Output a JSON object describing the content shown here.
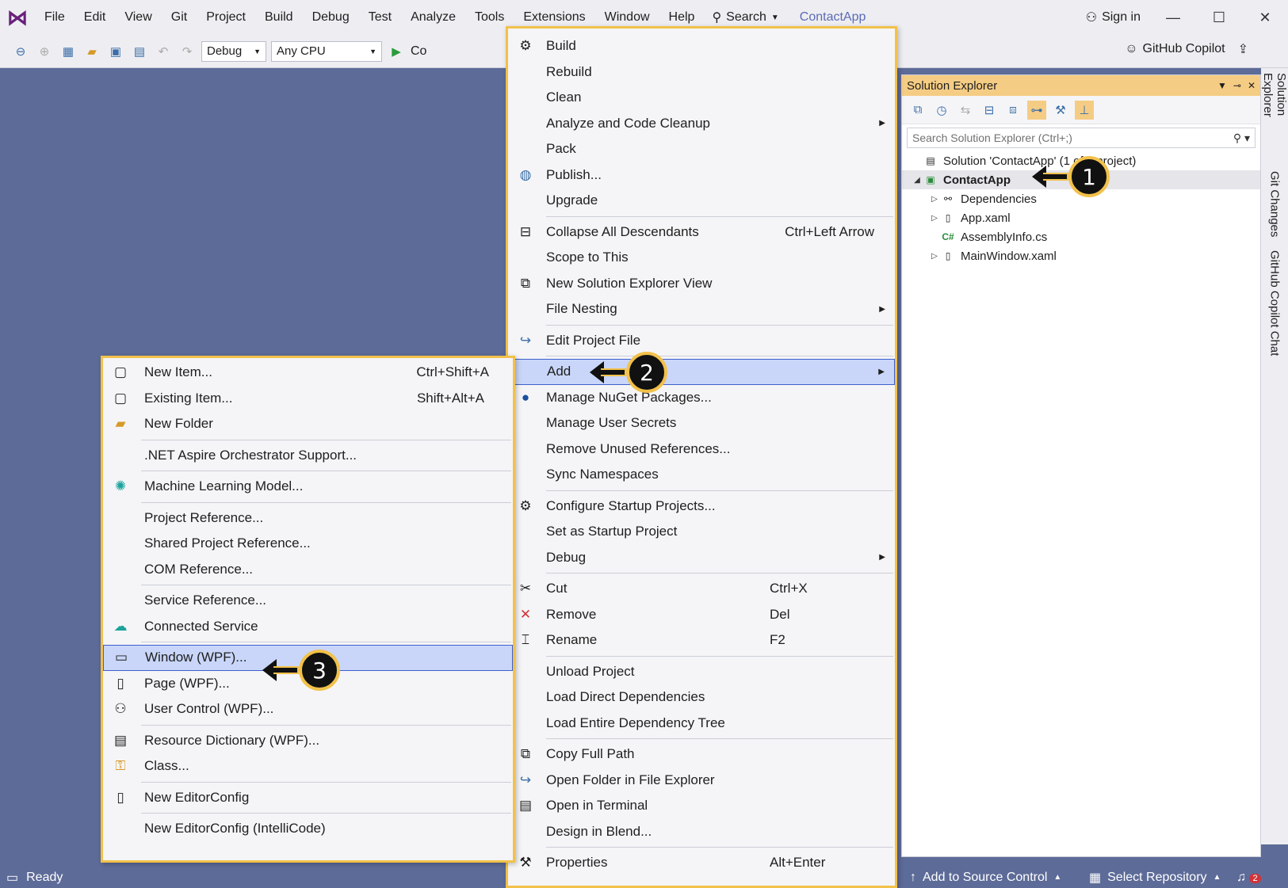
{
  "titlebar": {
    "menus": [
      "File",
      "Edit",
      "View",
      "Git",
      "Project",
      "Build",
      "Debug",
      "Test",
      "Analyze",
      "Tools",
      "Extensions",
      "Window",
      "Help"
    ],
    "search_label": "Search",
    "app_title": "ContactApp",
    "sign_in": "Sign in"
  },
  "toolbar": {
    "config": "Debug",
    "platform": "Any CPU",
    "run_label": "Co",
    "copilot": "GitHub Copilot"
  },
  "solution_explorer": {
    "title": "Solution Explorer",
    "search_placeholder": "Search Solution Explorer (Ctrl+;)",
    "solution": "Solution 'ContactApp' (1 of 1 project)",
    "project": "ContactApp",
    "items": [
      "Dependencies",
      "App.xaml",
      "AssemblyInfo.cs",
      "MainWindow.xaml"
    ]
  },
  "side_tabs": [
    "Solution Explorer",
    "Git Changes",
    "GitHub Copilot Chat"
  ],
  "main_menu": {
    "build": "Build",
    "rebuild": "Rebuild",
    "clean": "Clean",
    "analyze": "Analyze and Code Cleanup",
    "pack": "Pack",
    "publish": "Publish...",
    "upgrade": "Upgrade",
    "collapse": "Collapse All Descendants",
    "collapse_sc": "Ctrl+Left Arrow",
    "scope": "Scope to This",
    "new_view": "New Solution Explorer View",
    "file_nesting": "File Nesting",
    "edit_project": "Edit Project File",
    "add": "Add",
    "nuget": "Manage NuGet Packages...",
    "secrets": "Manage User Secrets",
    "remove_refs": "Remove Unused References...",
    "sync_ns": "Sync Namespaces",
    "config_startup": "Configure Startup Projects...",
    "set_startup": "Set as Startup Project",
    "debug": "Debug",
    "cut": "Cut",
    "cut_sc": "Ctrl+X",
    "remove": "Remove",
    "remove_sc": "Del",
    "rename": "Rename",
    "rename_sc": "F2",
    "unload": "Unload Project",
    "load_direct": "Load Direct Dependencies",
    "load_tree": "Load Entire Dependency Tree",
    "copy_path": "Copy Full Path",
    "open_folder": "Open Folder in File Explorer",
    "open_terminal": "Open in Terminal",
    "blend": "Design in Blend...",
    "properties": "Properties",
    "properties_sc": "Alt+Enter"
  },
  "add_menu": {
    "new_item": "New Item...",
    "new_item_sc": "Ctrl+Shift+A",
    "existing_item": "Existing Item...",
    "existing_item_sc": "Shift+Alt+A",
    "new_folder": "New Folder",
    "aspire": ".NET Aspire Orchestrator Support...",
    "ml_model": "Machine Learning Model...",
    "project_ref": "Project Reference...",
    "shared_ref": "Shared Project Reference...",
    "com_ref": "COM Reference...",
    "service_ref": "Service Reference...",
    "connected": "Connected Service",
    "window_wpf": "Window (WPF)...",
    "page_wpf": "Page (WPF)...",
    "user_control": "User Control (WPF)...",
    "resource_dict": "Resource Dictionary (WPF)...",
    "class": "Class...",
    "editorconfig": "New EditorConfig",
    "editorconfig_ic": "New EditorConfig (IntelliCode)"
  },
  "callouts": [
    "1",
    "2",
    "3"
  ],
  "statusbar": {
    "ready": "Ready",
    "source_control": "Add to Source Control",
    "select_repo": "Select Repository",
    "notifications": "2"
  },
  "colors": {
    "accent_yellow": "#f2c14a",
    "highlight": "#c9d6f9",
    "background": "#5d6b98"
  }
}
